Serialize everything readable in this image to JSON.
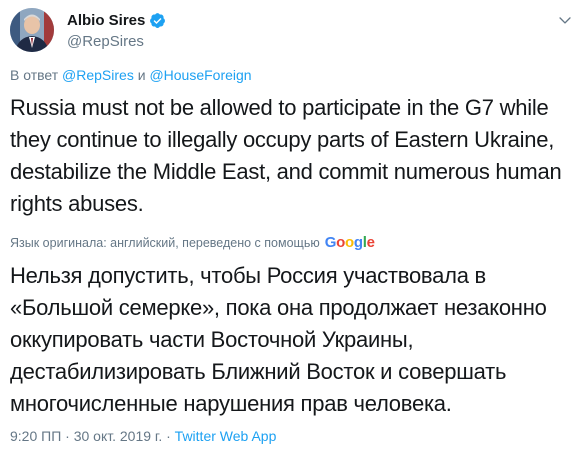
{
  "tweet": {
    "author": {
      "display_name": "Albio Sires",
      "handle": "@RepSires",
      "verified": true
    },
    "reply": {
      "prefix": "В ответ",
      "mention_1": "@RepSires",
      "conjunction": "и",
      "mention_2": "@HouseForeign"
    },
    "text": "Russia must not be allowed to participate in the G7 while they continue to illegally occupy parts of Eastern Ukraine, destabilize the Middle East, and commit numerous human rights abuses.",
    "translation": {
      "note": "Язык оригинала: английский, переведено с помощью",
      "provider_letters": [
        "G",
        "o",
        "o",
        "g",
        "l",
        "e"
      ],
      "provider_colors": [
        "#4285F4",
        "#EA4335",
        "#FBBC05",
        "#4285F4",
        "#34A853",
        "#EA4335"
      ],
      "text": "Нельзя допустить, чтобы Россия участвовала в «Большой семерке», пока она продолжает незаконно оккупировать части Восточной Украины, дестабилизировать Ближний Восток и совершать многочисленные нарушения прав человека."
    },
    "meta": {
      "time": "9:20 ПП",
      "separator_1": " · ",
      "date": "30 окт. 2019 г.",
      "separator_2": " · ",
      "source": "Twitter Web App"
    }
  },
  "colors": {
    "accent": "#1da1f2",
    "text": "#14171a",
    "secondary": "#657786"
  }
}
